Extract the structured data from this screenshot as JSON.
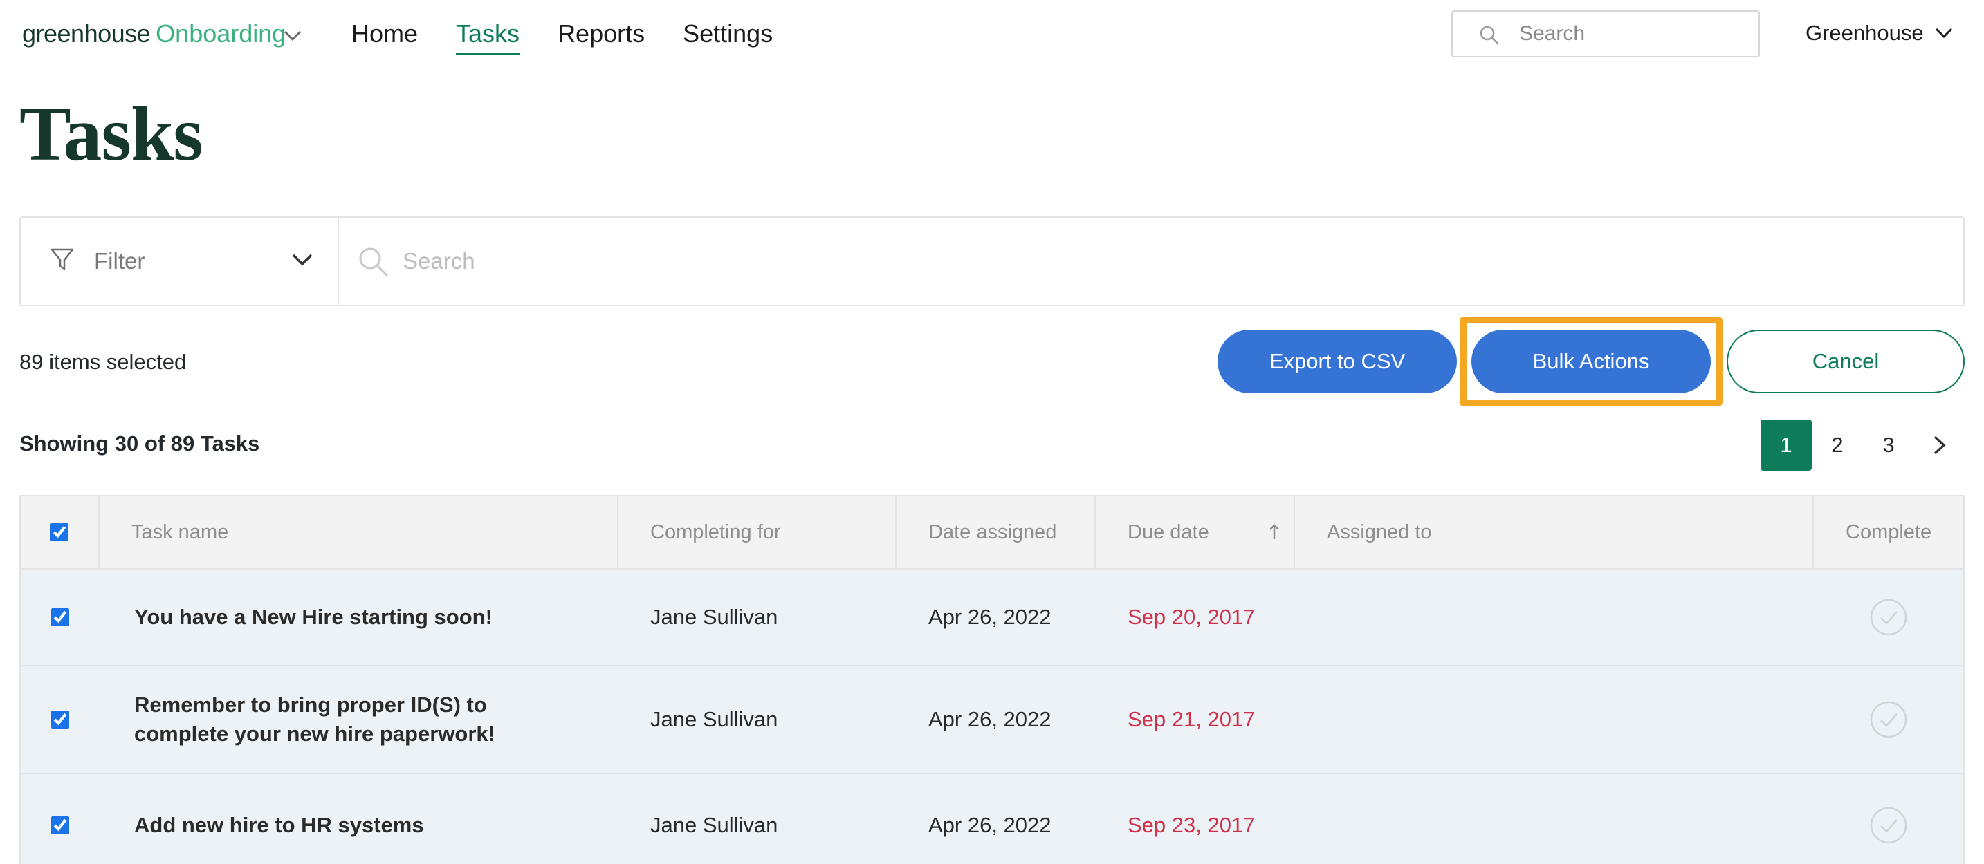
{
  "app": {
    "brand": "greenhouse",
    "product": "Onboarding"
  },
  "nav": {
    "items": [
      {
        "label": "Home",
        "active": false
      },
      {
        "label": "Tasks",
        "active": true
      },
      {
        "label": "Reports",
        "active": false
      },
      {
        "label": "Settings",
        "active": false
      }
    ]
  },
  "top_search": {
    "placeholder": "Search"
  },
  "account": {
    "name": "Greenhouse"
  },
  "page": {
    "title": "Tasks"
  },
  "filter": {
    "label": "Filter"
  },
  "search": {
    "placeholder": "Search"
  },
  "selection": {
    "count_text": "89 items selected",
    "export_label": "Export to CSV",
    "bulk_label": "Bulk Actions",
    "cancel_label": "Cancel"
  },
  "listing": {
    "showing_text": "Showing 30 of 89 Tasks",
    "pages": [
      "1",
      "2",
      "3"
    ],
    "current_page": "1"
  },
  "table": {
    "columns": {
      "task_name": "Task name",
      "completing_for": "Completing for",
      "date_assigned": "Date assigned",
      "due_date": "Due date",
      "assigned_to": "Assigned to",
      "complete": "Complete"
    },
    "rows": [
      {
        "task": "You have a New Hire starting soon!",
        "completing_for": "Jane Sullivan",
        "date_assigned": "Apr 26, 2022",
        "due_date": "Sep 20, 2017",
        "assigned_to": "",
        "checked": true
      },
      {
        "task": "Remember to bring proper ID(S) to complete your new hire paperwork!",
        "completing_for": "Jane Sullivan",
        "date_assigned": "Apr 26, 2022",
        "due_date": "Sep 21, 2017",
        "assigned_to": "",
        "checked": true
      },
      {
        "task": "Add new hire to HR systems",
        "completing_for": "Jane Sullivan",
        "date_assigned": "Apr 26, 2022",
        "due_date": "Sep 23, 2017",
        "assigned_to": "",
        "checked": true
      }
    ]
  },
  "colors": {
    "brand_green": "#0e7c5a",
    "logo_green": "#3ab07d",
    "primary_blue": "#3574d4",
    "overdue_red": "#d2304a",
    "highlight_orange": "#f5a623"
  },
  "icons": {
    "logo_chevron": "chevron-down-icon",
    "top_search": "search-icon",
    "account_chevron": "chevron-down-icon",
    "filter": "funnel-icon",
    "filter_chevron": "chevron-down-icon",
    "main_search": "search-icon",
    "sort": "arrow-up-icon",
    "next_page": "chevron-right-icon",
    "complete": "check-circle-icon"
  }
}
